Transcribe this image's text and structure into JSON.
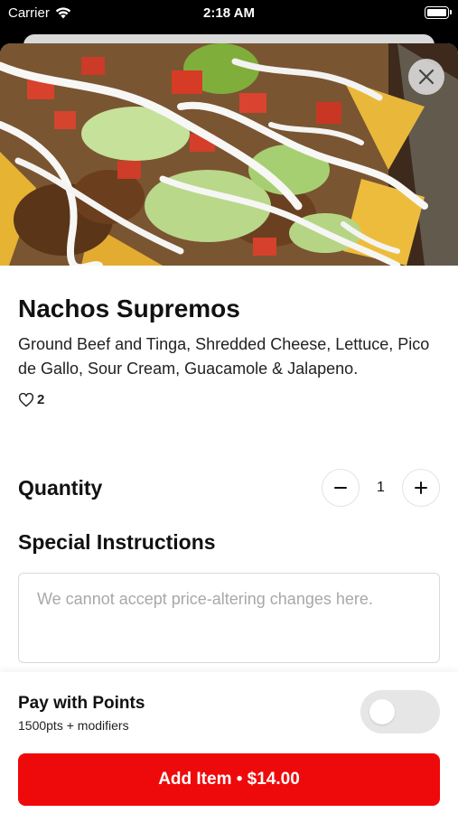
{
  "status_bar": {
    "carrier": "Carrier",
    "time": "2:18 AM"
  },
  "item": {
    "image_icon": "nachos-photo",
    "title": "Nachos Supremos",
    "description": "Ground Beef and Tinga, Shredded Cheese, Lettuce, Pico de Gallo, Sour Cream, Guacamole & Jalapeno.",
    "likes": "2"
  },
  "quantity": {
    "label": "Quantity",
    "value": "1",
    "decrement_icon": "minus-icon",
    "increment_icon": "plus-icon"
  },
  "instructions": {
    "label": "Special Instructions",
    "placeholder": "We cannot accept price-altering changes here.",
    "value": ""
  },
  "points": {
    "label": "Pay with Points",
    "sublabel": "1500pts + modifiers",
    "enabled": false
  },
  "add_button": {
    "label": "Add Item • $14.00"
  },
  "colors": {
    "accent": "#ee0a0a",
    "toggle_off": "#e6e6e6"
  }
}
